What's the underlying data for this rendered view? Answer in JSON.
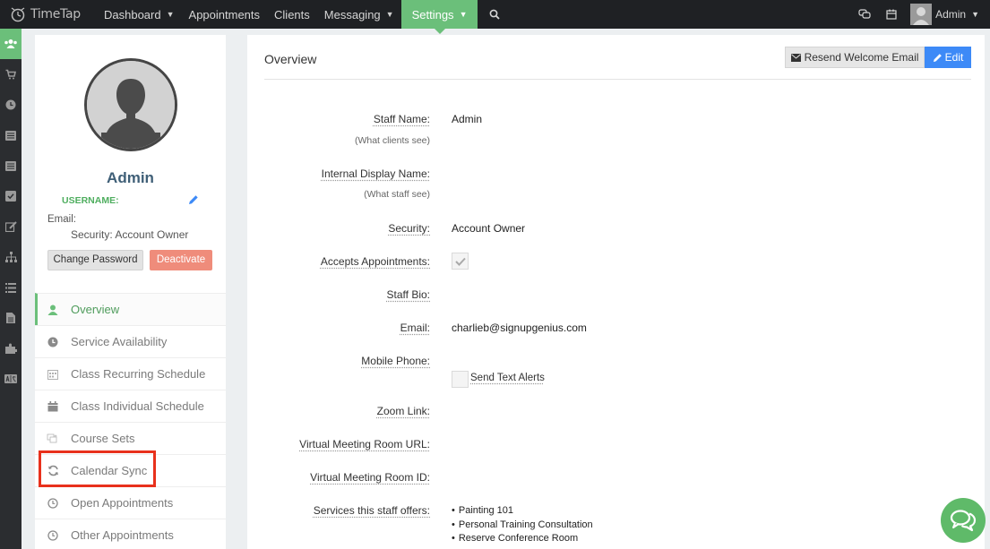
{
  "topnav": {
    "logo_text": "TimeTap",
    "items": [
      {
        "label": "Dashboard",
        "chevron": true
      },
      {
        "label": "Appointments",
        "chevron": false
      },
      {
        "label": "Clients",
        "chevron": false
      },
      {
        "label": "Messaging",
        "chevron": true
      },
      {
        "label": "Settings",
        "chevron": true,
        "active": true
      }
    ],
    "user_label": "Admin"
  },
  "rail": {
    "icons": [
      "staff-icon",
      "cart-icon",
      "clock-icon",
      "list-icon",
      "list-alt-icon",
      "check-square-icon",
      "edit-icon",
      "sitemap-icon",
      "list-lines-icon",
      "file-icon",
      "puzzle-icon",
      "translate-icon"
    ],
    "active_index": 0
  },
  "profile": {
    "name": "Admin",
    "username_label": "USERNAME:",
    "email_label": "Email:",
    "security_line": "Security: Account Owner",
    "change_password": "Change Password",
    "deactivate": "Deactivate"
  },
  "menu": {
    "items": [
      {
        "label": "Overview",
        "icon": "user-icon",
        "active": true
      },
      {
        "label": "Service Availability",
        "icon": "clock-icon"
      },
      {
        "label": "Class Recurring Schedule",
        "icon": "calendar-grid-icon"
      },
      {
        "label": "Class Individual Schedule",
        "icon": "calendar-icon"
      },
      {
        "label": "Course Sets",
        "icon": "course-sets-icon"
      },
      {
        "label": "Calendar Sync",
        "icon": "refresh-icon",
        "highlighted": true
      },
      {
        "label": "Open Appointments",
        "icon": "clock-outline-icon"
      },
      {
        "label": "Other Appointments",
        "icon": "clock-outline-icon"
      }
    ]
  },
  "main": {
    "title": "Overview",
    "resend_label": "Resend Welcome Email",
    "edit_label": "Edit",
    "fields": {
      "staff_name": {
        "label": "Staff Name:",
        "hint": "(What clients see)",
        "value": "Admin"
      },
      "internal_name": {
        "label": "Internal Display Name:",
        "hint": "(What staff see)",
        "value": ""
      },
      "security": {
        "label": "Security:",
        "value": "Account Owner"
      },
      "accepts": {
        "label": "Accepts Appointments:",
        "checked": true
      },
      "bio": {
        "label": "Staff Bio:",
        "value": ""
      },
      "email": {
        "label": "Email:",
        "value": "charlieb@signupgenius.com"
      },
      "mobile": {
        "label": "Mobile Phone:",
        "value": "",
        "send_text_alerts": "Send Text Alerts"
      },
      "zoom": {
        "label": "Zoom Link:",
        "value": ""
      },
      "vm_url": {
        "label": "Virtual Meeting Room URL:",
        "value": ""
      },
      "vm_id": {
        "label": "Virtual Meeting Room ID:",
        "value": ""
      },
      "services": {
        "label": "Services this staff offers:",
        "items": [
          "Painting 101",
          "Personal Training Consultation",
          "Reserve Conference Room"
        ]
      }
    }
  },
  "colors": {
    "accent_green": "#6bbf7a",
    "edit_blue": "#3d8af7",
    "deactivate_red": "#ef8c7b",
    "highlight_red": "#e8311c",
    "name_blue": "#3f5f77"
  }
}
